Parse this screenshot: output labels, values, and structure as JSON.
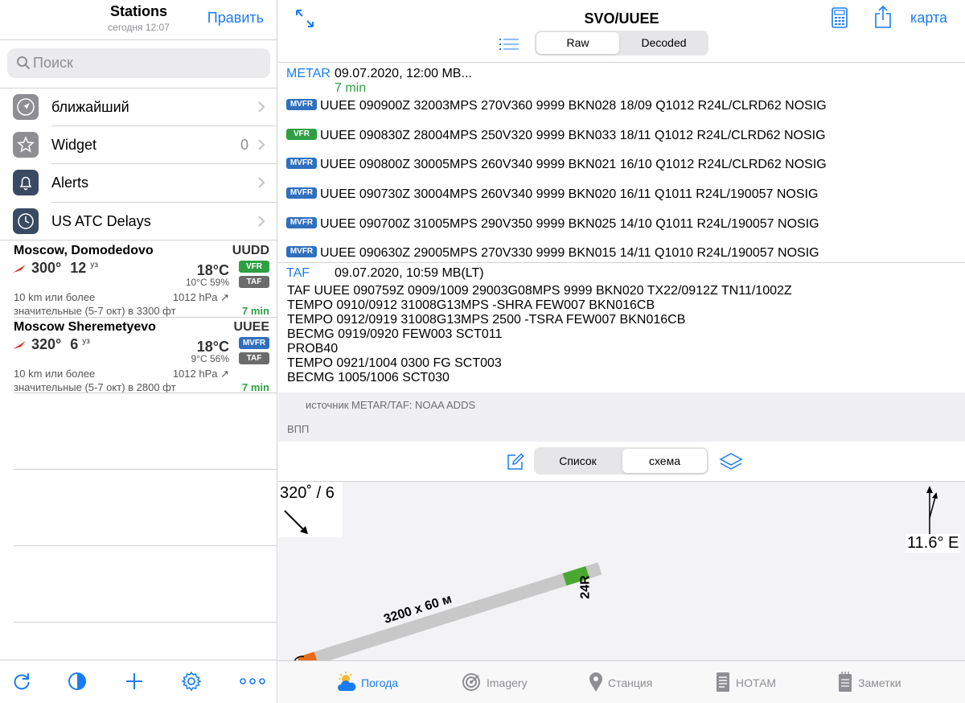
{
  "left": {
    "title": "Stations",
    "subtitle": "сегодня 12:07",
    "edit_label": "Править",
    "search_placeholder": "Поиск",
    "menu": [
      {
        "label": "ближайший",
        "count": ""
      },
      {
        "label": "Widget",
        "count": "0"
      },
      {
        "label": "Alerts",
        "count": ""
      },
      {
        "label": "US ATC Delays",
        "count": ""
      }
    ],
    "stations": [
      {
        "name": "Moscow, Domodedovo",
        "code": "UUDD",
        "wind_dir": "300°",
        "wind_speed": "12",
        "wind_unit": "уз",
        "temp": "18°C",
        "dew_rh": "10°C 59%",
        "cat": "VFR",
        "taf": "TAF",
        "vis": "10 km или более",
        "pressure": "1012 hPa ↗",
        "clouds": "значительные (5-7 окт) в 3300 фт",
        "age": "7 min"
      },
      {
        "name": "Moscow Sheremetyevo",
        "code": "UUEE",
        "wind_dir": "320°",
        "wind_speed": "6",
        "wind_unit": "уз",
        "temp": "18°C",
        "dew_rh": "9°C 56%",
        "cat": "MVFR",
        "taf": "TAF",
        "vis": "10 km или более",
        "pressure": "1012 hPa ↗",
        "clouds": "значительные (5-7 окт) в 2800 фт",
        "age": "7 min"
      }
    ]
  },
  "right": {
    "title": "SVO/UUEE",
    "map_label": "карта",
    "seg1": [
      "Raw",
      "Decoded"
    ],
    "metar": {
      "label": "METAR",
      "date": "09.07.2020, 12:00 MB...",
      "age": "7 min",
      "rows": [
        {
          "cat": "MVFR",
          "text": "UUEE 090900Z 32003MPS 270V360 9999 BKN028 18/09 Q1012 R24L/CLRD62 NOSIG"
        },
        {
          "cat": "VFR",
          "text": "UUEE 090830Z 28004MPS 250V320 9999 BKN033 18/11 Q1012 R24L/CLRD62 NOSIG"
        },
        {
          "cat": "MVFR",
          "text": "UUEE 090800Z 30005MPS 260V340 9999 BKN021 16/10 Q1012 R24L/CLRD62 NOSIG"
        },
        {
          "cat": "MVFR",
          "text": "UUEE 090730Z 30004MPS 260V340 9999 BKN020 16/11 Q1011 R24L/190057 NOSIG"
        },
        {
          "cat": "MVFR",
          "text": "UUEE 090700Z 31005MPS 290V350 9999 BKN025 14/10 Q1011 R24L/190057 NOSIG"
        },
        {
          "cat": "MVFR",
          "text": "UUEE 090630Z 29005MPS 270V330 9999 BKN015 14/11 Q1010 R24L/190057 NOSIG"
        }
      ]
    },
    "taf": {
      "label": "TAF",
      "date": "09.07.2020, 10:59 MB(LT)",
      "lines": [
        "TAF UUEE 090759Z 0909/1009 29003G08MPS 9999 BKN020 TX22/0912Z TN11/1002Z",
        "TEMPO 0910/0912 31008G13MPS -SHRA FEW007 BKN016CB",
        "TEMPO 0912/0919 31008G13MPS 2500 -TSRA FEW007 BKN016CB",
        "BECMG 0919/0920 FEW003 SCT011",
        "PROB40",
        "TEMPO 0921/1004 0300 FG SCT003",
        "BECMG 1005/1006 SCT030"
      ]
    },
    "source": "источник METAR/TAF: NOAA ADDS",
    "runways_header": "ВПП",
    "seg2": [
      "Список",
      "схема"
    ],
    "diagram": {
      "wind": "320˚ / 6",
      "declination": "11.6° E",
      "runway_label": "3200 x 60 м",
      "runway_end": "24R"
    },
    "tabs": [
      "Погода",
      "Imagery",
      "Станция",
      "НОТАМ",
      "Заметки"
    ]
  },
  "colors": {
    "accent": "#1a7cf2",
    "vfr": "#2ea043",
    "mvfr": "#2f6fbd",
    "taf_badge": "#6b6b6b"
  }
}
